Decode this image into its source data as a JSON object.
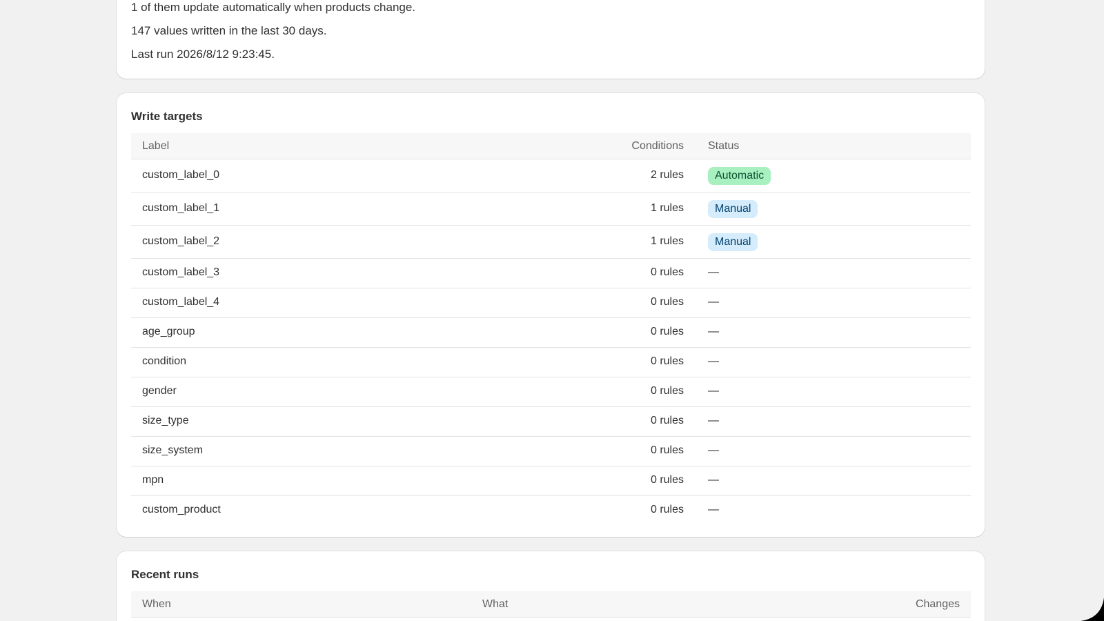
{
  "summary": {
    "line1": "1 of them update automatically when products change.",
    "line2": "147 values written in the last 30 days.",
    "line3": "Last run 2026/8/12 9:23:45."
  },
  "write_targets": {
    "title": "Write targets",
    "headers": {
      "label": "Label",
      "conditions": "Conditions",
      "status": "Status"
    },
    "rows": [
      {
        "label": "custom_label_0",
        "conditions": "2 rules",
        "status": "Automatic"
      },
      {
        "label": "custom_label_1",
        "conditions": "1 rules",
        "status": "Manual"
      },
      {
        "label": "custom_label_2",
        "conditions": "1 rules",
        "status": "Manual"
      },
      {
        "label": "custom_label_3",
        "conditions": "0 rules",
        "status": "—"
      },
      {
        "label": "custom_label_4",
        "conditions": "0 rules",
        "status": "—"
      },
      {
        "label": "age_group",
        "conditions": "0 rules",
        "status": "—"
      },
      {
        "label": "condition",
        "conditions": "0 rules",
        "status": "—"
      },
      {
        "label": "gender",
        "conditions": "0 rules",
        "status": "—"
      },
      {
        "label": "size_type",
        "conditions": "0 rules",
        "status": "—"
      },
      {
        "label": "size_system",
        "conditions": "0 rules",
        "status": "—"
      },
      {
        "label": "mpn",
        "conditions": "0 rules",
        "status": "—"
      },
      {
        "label": "custom_product",
        "conditions": "0 rules",
        "status": "—"
      }
    ]
  },
  "recent_runs": {
    "title": "Recent runs",
    "headers": {
      "when": "When",
      "what": "What",
      "changes": "Changes"
    }
  },
  "colors": {
    "automatic_badge_bg": "#a8f0c0",
    "automatic_badge_text": "#0c5132",
    "manual_badge_bg": "#d4ecfb",
    "manual_badge_text": "#00416e",
    "page_bg": "#f1f1f1"
  }
}
